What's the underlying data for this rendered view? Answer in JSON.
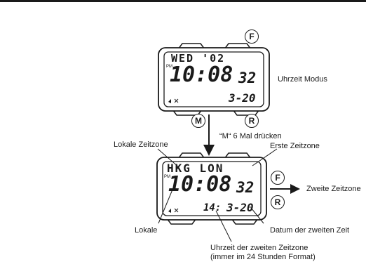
{
  "watch_top": {
    "day_date": "WED '02",
    "pm": "PM",
    "time": "10:08",
    "seconds": "32",
    "date": "3-20",
    "buttons": {
      "f": "F",
      "m": "M",
      "r": "R"
    }
  },
  "watch_bottom": {
    "zones": "HKG LON",
    "pm": "PM",
    "time": "10:08",
    "seconds": "32",
    "second_zone_hour": "14:",
    "date": "3-20",
    "buttons": {
      "f": "F",
      "r": "R"
    }
  },
  "labels": {
    "mode": "Uhrzeit Modus",
    "press": "“M“ 6 Mal drücken",
    "local_zone": "Lokale Zeitzone",
    "first_zone": "Erste Zeitzone",
    "second_zone": "Zweite Zeitzone",
    "local": "Lokale",
    "second_date": "Datum der zweiten Zeit",
    "second_time_line1": "Uhrzeit der zweiten Zeitzone",
    "second_time_line2": "(immer im 24 Stunden Format)"
  }
}
